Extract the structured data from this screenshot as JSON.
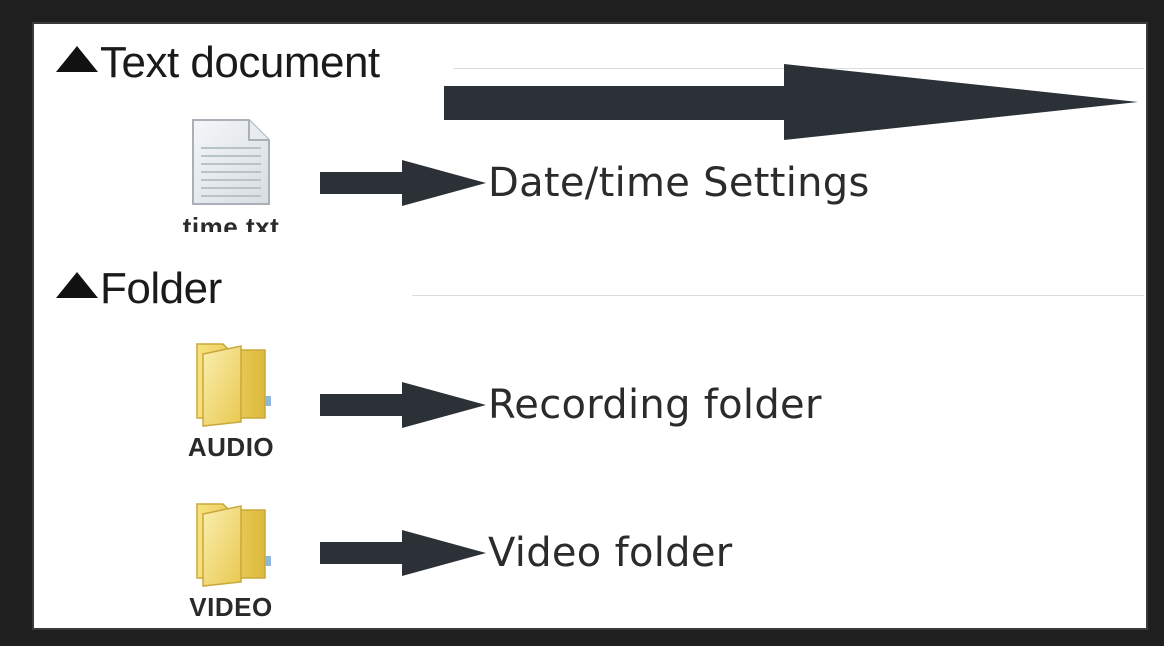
{
  "sections": {
    "text_document": {
      "label": "Text document",
      "files": [
        {
          "name": "time.txt",
          "icon": "text-file-icon",
          "description": "Date/time Settings"
        }
      ]
    },
    "folder": {
      "label": "Folder",
      "files": [
        {
          "name": "AUDIO",
          "icon": "folder-icon",
          "description": "Recording folder"
        },
        {
          "name": "VIDEO",
          "icon": "folder-icon",
          "description": "Video folder"
        }
      ]
    }
  },
  "colors": {
    "frame": "#1f1f1f",
    "arrow": "#2b3136",
    "folder_yellow": "#f3dc6b",
    "text": "#1a1a1a"
  }
}
